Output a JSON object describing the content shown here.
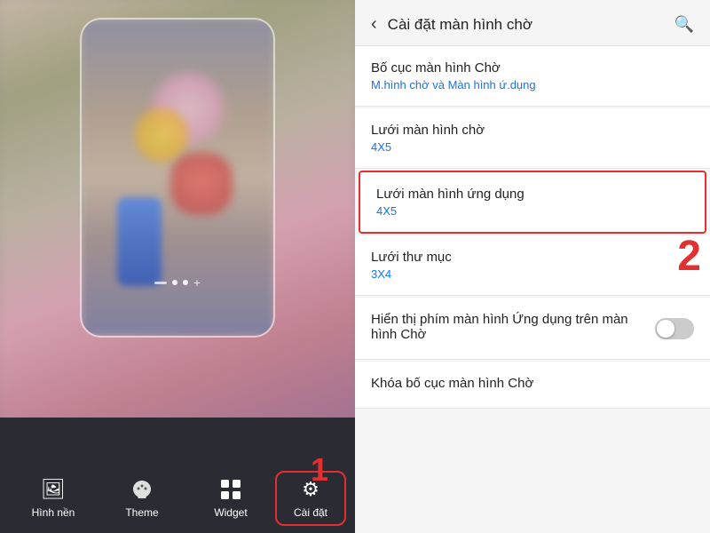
{
  "left": {
    "nav": {
      "items": [
        {
          "id": "wallpaper",
          "label": "Hình nền",
          "icon": "image-icon"
        },
        {
          "id": "theme",
          "label": "Theme",
          "icon": "theme-icon"
        },
        {
          "id": "widget",
          "label": "Widget",
          "icon": "widget-icon"
        },
        {
          "id": "settings",
          "label": "Cài đặt",
          "icon": "settings-icon"
        }
      ],
      "highlighted": "settings"
    },
    "step_label": "1"
  },
  "right": {
    "header": {
      "back_label": "‹",
      "title": "Cài đặt màn hình chờ",
      "search_icon": "search-icon"
    },
    "items": [
      {
        "id": "layout",
        "title": "Bố cục màn hình Chờ",
        "subtitle": "M.hình chờ và Màn hình ứ.dụng",
        "has_toggle": false,
        "highlighted": false
      },
      {
        "id": "home-grid",
        "title": "Lưới màn hình chờ",
        "subtitle": "4X5",
        "has_toggle": false,
        "highlighted": false
      },
      {
        "id": "app-grid",
        "title": "Lưới màn hình ứng dụng",
        "subtitle": "4X5",
        "has_toggle": false,
        "highlighted": true
      },
      {
        "id": "folder-grid",
        "title": "Lưới thư mục",
        "subtitle": "3X4",
        "has_toggle": false,
        "highlighted": false
      },
      {
        "id": "app-screen-btn",
        "title": "Hiển thị phím màn hình Ứng dụng trên màn hình Chờ",
        "subtitle": "",
        "has_toggle": true,
        "highlighted": false
      },
      {
        "id": "lock-layout",
        "title": "Khóa bố cục màn hình Chờ",
        "subtitle": "",
        "has_toggle": false,
        "highlighted": false
      }
    ],
    "step_label": "2"
  }
}
